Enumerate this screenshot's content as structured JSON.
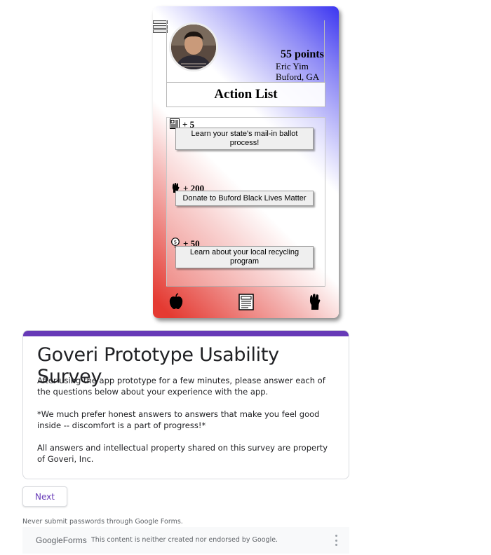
{
  "profile": {
    "points": "55 points",
    "name": "Eric Yim",
    "location": "Buford, GA"
  },
  "action_list": {
    "title": "Action List",
    "items": [
      {
        "points": "+ 5",
        "label": "Learn your state's mail-in ballot process!",
        "icon": "newspaper-icon"
      },
      {
        "points": "+ 200",
        "label": "Donate to Buford Black Lives Matter",
        "icon": "raised-fist-icon"
      },
      {
        "points": "+ 50",
        "label": "Learn about your local recycling program",
        "icon": "recycle-coin-icon"
      }
    ]
  },
  "bottom_nav": [
    "apple-icon",
    "document-icon",
    "raised-fist-icon"
  ],
  "colors": {
    "gradient_blue": "#3b35f0",
    "gradient_red": "#e43a32",
    "form_accent": "#673ab7"
  },
  "form": {
    "title": "Goveri Prototype Usability Survey",
    "desc1": "After using the app prototype for a few minutes, please answer each of the questions below about your experience with the app.",
    "desc2": "*We much prefer honest answers to answers that make you feel good inside -- discomfort is a part of progress!*",
    "desc3": "All answers and intellectual property shared on this survey are property of Goveri, Inc.",
    "next_label": "Next",
    "warning": "Never submit passwords through Google Forms."
  },
  "footer": {
    "brand_google": "Google",
    "brand_forms": "Forms",
    "note": "This content is neither created nor endorsed by Google."
  }
}
